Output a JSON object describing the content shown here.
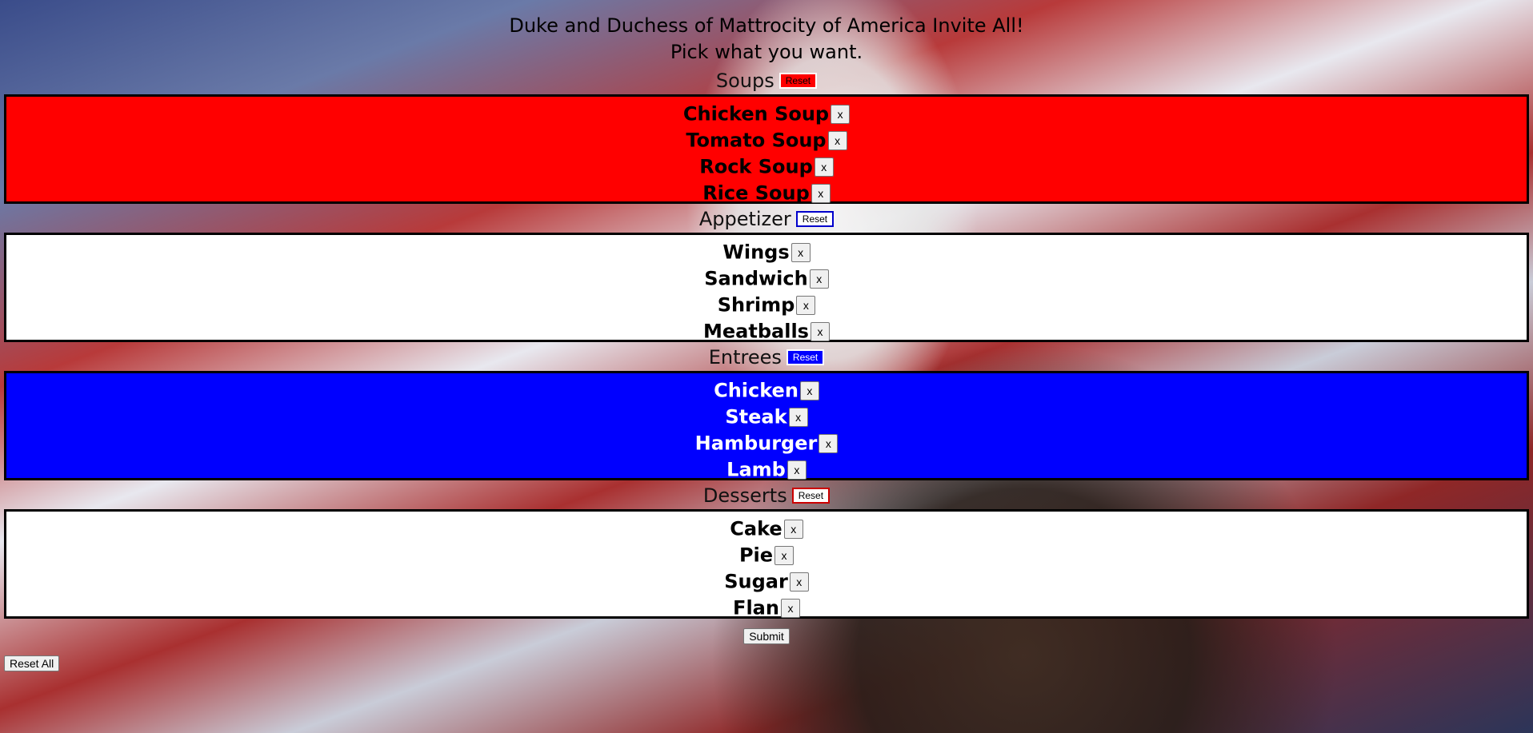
{
  "header": {
    "title": "Duke and Duchess of Mattrocity of America Invite All!",
    "subtitle": "Pick what you want."
  },
  "sections": [
    {
      "title": "Soups",
      "reset_label": "Reset",
      "panel_bg": "#ff0000",
      "text_color": "#000000",
      "reset_bg": "#ff0000",
      "reset_fg": "#000000",
      "reset_border": "#ffffff",
      "items": [
        {
          "label": "Chicken Soup",
          "x": "x"
        },
        {
          "label": "Tomato Soup",
          "x": "x"
        },
        {
          "label": "Rock Soup",
          "x": "x"
        },
        {
          "label": "Rice Soup",
          "x": "x"
        }
      ]
    },
    {
      "title": "Appetizer",
      "reset_label": "Reset",
      "panel_bg": "#ffffff",
      "text_color": "#000000",
      "reset_bg": "#ffffff",
      "reset_fg": "#000000",
      "reset_border": "#0000cc",
      "items": [
        {
          "label": "Wings",
          "x": "x"
        },
        {
          "label": "Sandwich",
          "x": "x"
        },
        {
          "label": "Shrimp",
          "x": "x"
        },
        {
          "label": "Meatballs",
          "x": "x"
        }
      ]
    },
    {
      "title": "Entrees",
      "reset_label": "Reset",
      "panel_bg": "#0000ff",
      "text_color": "#ffffff",
      "reset_bg": "#0000ff",
      "reset_fg": "#ffffff",
      "reset_border": "#ffffff",
      "items": [
        {
          "label": "Chicken",
          "x": "x"
        },
        {
          "label": "Steak",
          "x": "x"
        },
        {
          "label": "Hamburger",
          "x": "x"
        },
        {
          "label": "Lamb",
          "x": "x"
        }
      ]
    },
    {
      "title": "Desserts",
      "reset_label": "Reset",
      "panel_bg": "#ffffff",
      "text_color": "#000000",
      "reset_bg": "#ffffff",
      "reset_fg": "#000000",
      "reset_border": "#cc0000",
      "items": [
        {
          "label": "Cake",
          "x": "x"
        },
        {
          "label": "Pie",
          "x": "x"
        },
        {
          "label": "Sugar",
          "x": "x"
        },
        {
          "label": "Flan",
          "x": "x"
        }
      ]
    }
  ],
  "actions": {
    "submit_label": "Submit",
    "reset_all_label": "Reset All"
  }
}
